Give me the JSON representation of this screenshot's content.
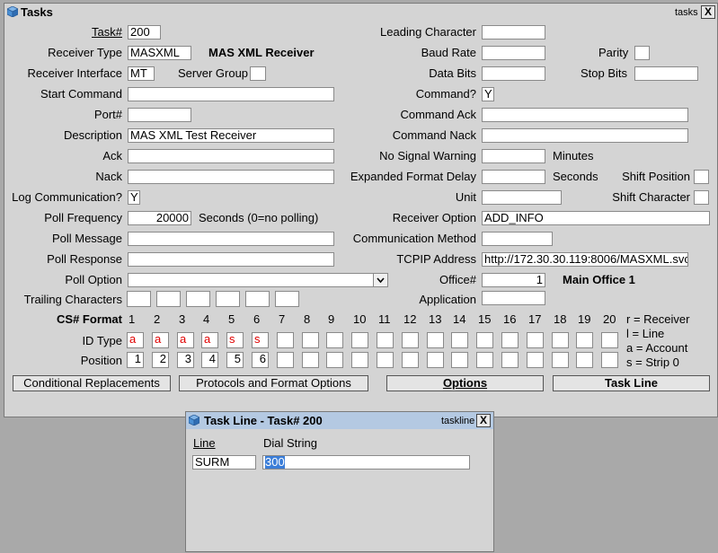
{
  "tasks_window": {
    "title": "Tasks",
    "tag": "tasks",
    "close": "X",
    "left": {
      "task_label": "Task#",
      "task_value": "200",
      "receiver_type_label": "Receiver Type",
      "receiver_type_value": "MASXML",
      "receiver_type_desc": "MAS XML Receiver",
      "receiver_interface_label": "Receiver Interface",
      "receiver_interface_value": "MT",
      "server_group_label": "Server Group",
      "server_group_value": "",
      "start_command_label": "Start Command",
      "start_command_value": "",
      "port_label": "Port#",
      "port_value": "",
      "description_label": "Description",
      "description_value": "MAS XML Test Receiver",
      "ack_label": "Ack",
      "ack_value": "",
      "nack_label": "Nack",
      "nack_value": "",
      "log_comm_label": "Log Communication?",
      "log_comm_value": "Y",
      "poll_freq_label": "Poll Frequency",
      "poll_freq_value": "20000",
      "poll_freq_note": "Seconds (0=no polling)",
      "poll_message_label": "Poll Message",
      "poll_message_value": "",
      "poll_response_label": "Poll Response",
      "poll_response_value": "",
      "poll_option_label": "Poll Option",
      "poll_option_value": "",
      "trailing_label": "Trailing Characters"
    },
    "right": {
      "leading_char_label": "Leading Character",
      "leading_char_value": "",
      "baud_label": "Baud Rate",
      "baud_value": "",
      "parity_label": "Parity",
      "parity_value": "",
      "data_bits_label": "Data Bits",
      "data_bits_value": "",
      "stop_bits_label": "Stop Bits",
      "stop_bits_value": "",
      "command_q_label": "Command?",
      "command_q_value": "Y",
      "command_ack_label": "Command Ack",
      "command_ack_value": "",
      "command_nack_label": "Command Nack",
      "command_nack_value": "",
      "no_signal_label": "No Signal Warning",
      "no_signal_value": "",
      "no_signal_unit": "Minutes",
      "exp_delay_label": "Expanded Format Delay",
      "exp_delay_value": "",
      "exp_delay_unit": "Seconds",
      "shift_pos_label": "Shift Position",
      "shift_pos_value": "",
      "unit_label": "Unit",
      "unit_value": "",
      "shift_char_label": "Shift Character",
      "shift_char_value": "",
      "receiver_option_label": "Receiver Option",
      "receiver_option_value": "ADD_INFO",
      "comm_method_label": "Communication Method",
      "comm_method_value": "",
      "tcpip_label": "TCPIP Address",
      "tcpip_value": "http://172.30.30.119:8006/MASXML.svc/",
      "office_label": "Office#",
      "office_value": "1",
      "office_desc": "Main Office 1",
      "application_label": "Application",
      "application_value": ""
    },
    "cs_format": {
      "label": "CS# Format",
      "columns": [
        "1",
        "2",
        "3",
        "4",
        "5",
        "6",
        "7",
        "8",
        "9",
        "10",
        "11",
        "12",
        "13",
        "14",
        "15",
        "16",
        "17",
        "18",
        "19",
        "20"
      ],
      "id_type_label": "ID Type",
      "id_types": [
        "a",
        "a",
        "a",
        "a",
        "s",
        "s",
        "",
        "",
        "",
        "",
        "",
        "",
        "",
        "",
        "",
        "",
        "",
        "",
        "",
        ""
      ],
      "position_label": "Position",
      "positions": [
        "1",
        "2",
        "3",
        "4",
        "5",
        "6",
        "",
        "",
        "",
        "",
        "",
        "",
        "",
        "",
        "",
        "",
        "",
        "",
        "",
        ""
      ],
      "legend": [
        "r = Receiver",
        "l = Line",
        "a = Account",
        "s = Strip 0"
      ]
    },
    "buttons": {
      "conditional": "Conditional Replacements",
      "protocols": "Protocols and Format Options",
      "options": "Options",
      "task_line": "Task Line"
    }
  },
  "taskline_window": {
    "title": "Task Line - Task# 200",
    "tag": "taskline",
    "close": "X",
    "line_header": "Line",
    "dial_header": "Dial String",
    "line_value": "SURM",
    "dial_value": "300"
  },
  "colors": {
    "window_bg": "#d4d4d4",
    "desktop_bg": "#a9a9a9",
    "id_type_text": "#e00000",
    "selection": "#3a7dd8"
  }
}
